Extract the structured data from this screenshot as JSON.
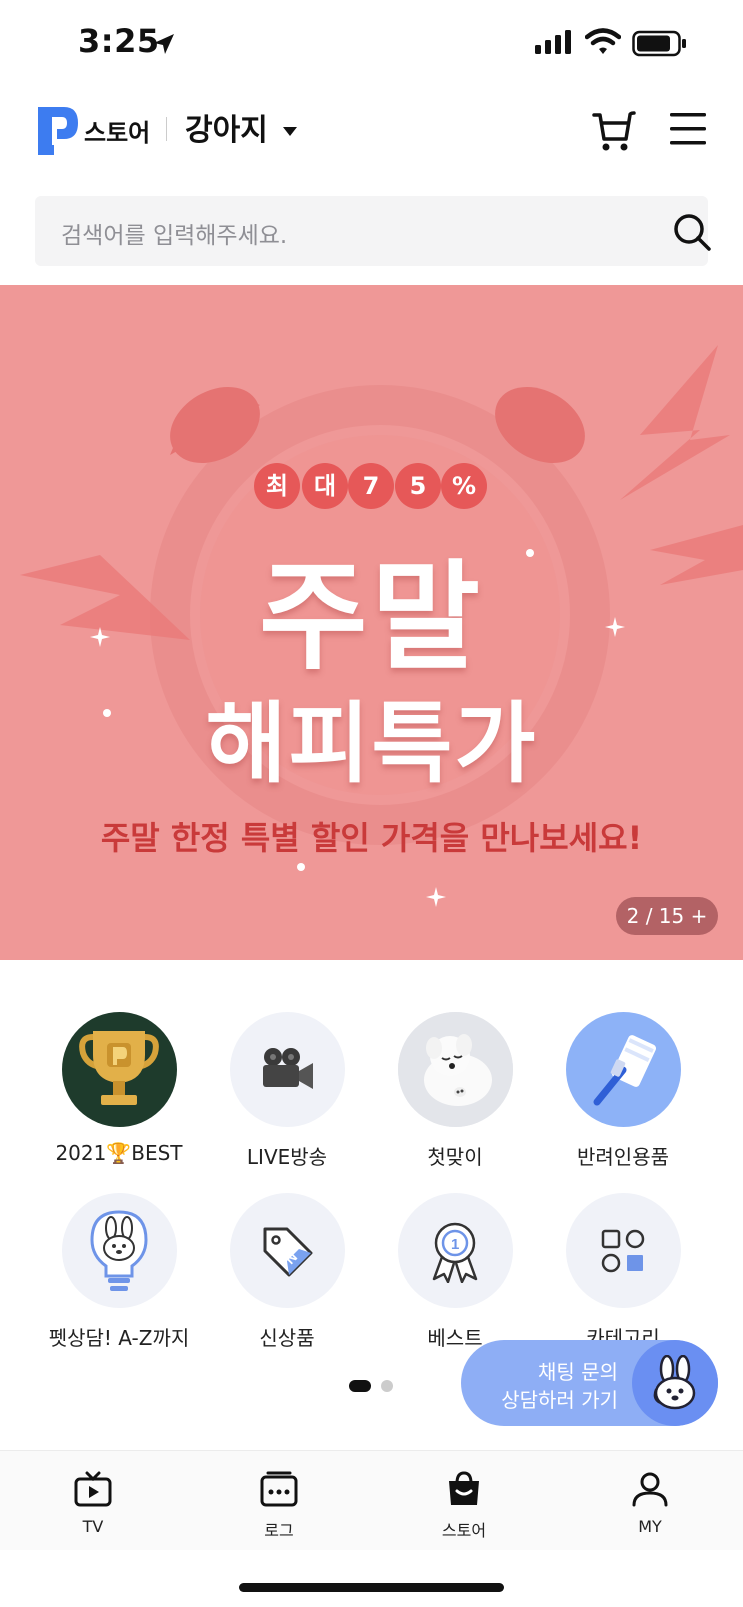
{
  "status_bar": {
    "time": "3:25"
  },
  "header": {
    "logo_text": "스토어",
    "category": "강아지"
  },
  "search": {
    "placeholder": "검색어를 입력해주세요."
  },
  "banner": {
    "badge_chars": [
      "최",
      "대",
      "7",
      "5",
      "%"
    ],
    "headline_1": "주말",
    "headline_2": "해피특가",
    "subtitle": "주말 한정 특별 할인 가격을 만나보세요!",
    "counter": "2 / 15  +"
  },
  "quick_menu": {
    "items": [
      {
        "label": "2021🏆BEST",
        "icon": "trophy-icon"
      },
      {
        "label": "LIVE방송",
        "icon": "movie-camera-icon"
      },
      {
        "label": "첫맞이",
        "icon": "puppy-photo"
      },
      {
        "label": "반려인용품",
        "icon": "lint-roller-icon"
      },
      {
        "label": "펫상담! A-Z까지",
        "icon": "lightbulb-bunny-icon"
      },
      {
        "label": "신상품",
        "icon": "tag-icon"
      },
      {
        "label": "베스트",
        "icon": "medal-icon"
      },
      {
        "label": "카테고리",
        "icon": "category-grid-icon"
      }
    ],
    "page": 1,
    "pages": 2
  },
  "chat": {
    "line1": "채팅 문의",
    "line2": "상담하러 가기"
  },
  "tabbar": {
    "tabs": [
      {
        "label": "TV",
        "icon": "tv-icon"
      },
      {
        "label": "로그",
        "icon": "log-icon"
      },
      {
        "label": "스토어",
        "icon": "shopping-bag-icon",
        "active": true
      },
      {
        "label": "MY",
        "icon": "person-icon"
      }
    ]
  },
  "colors": {
    "banner_bg": "#ef9897",
    "accent_red": "#e65858",
    "chat_blue": "#8eaef5",
    "logo_blue": "#3d7cf0"
  }
}
